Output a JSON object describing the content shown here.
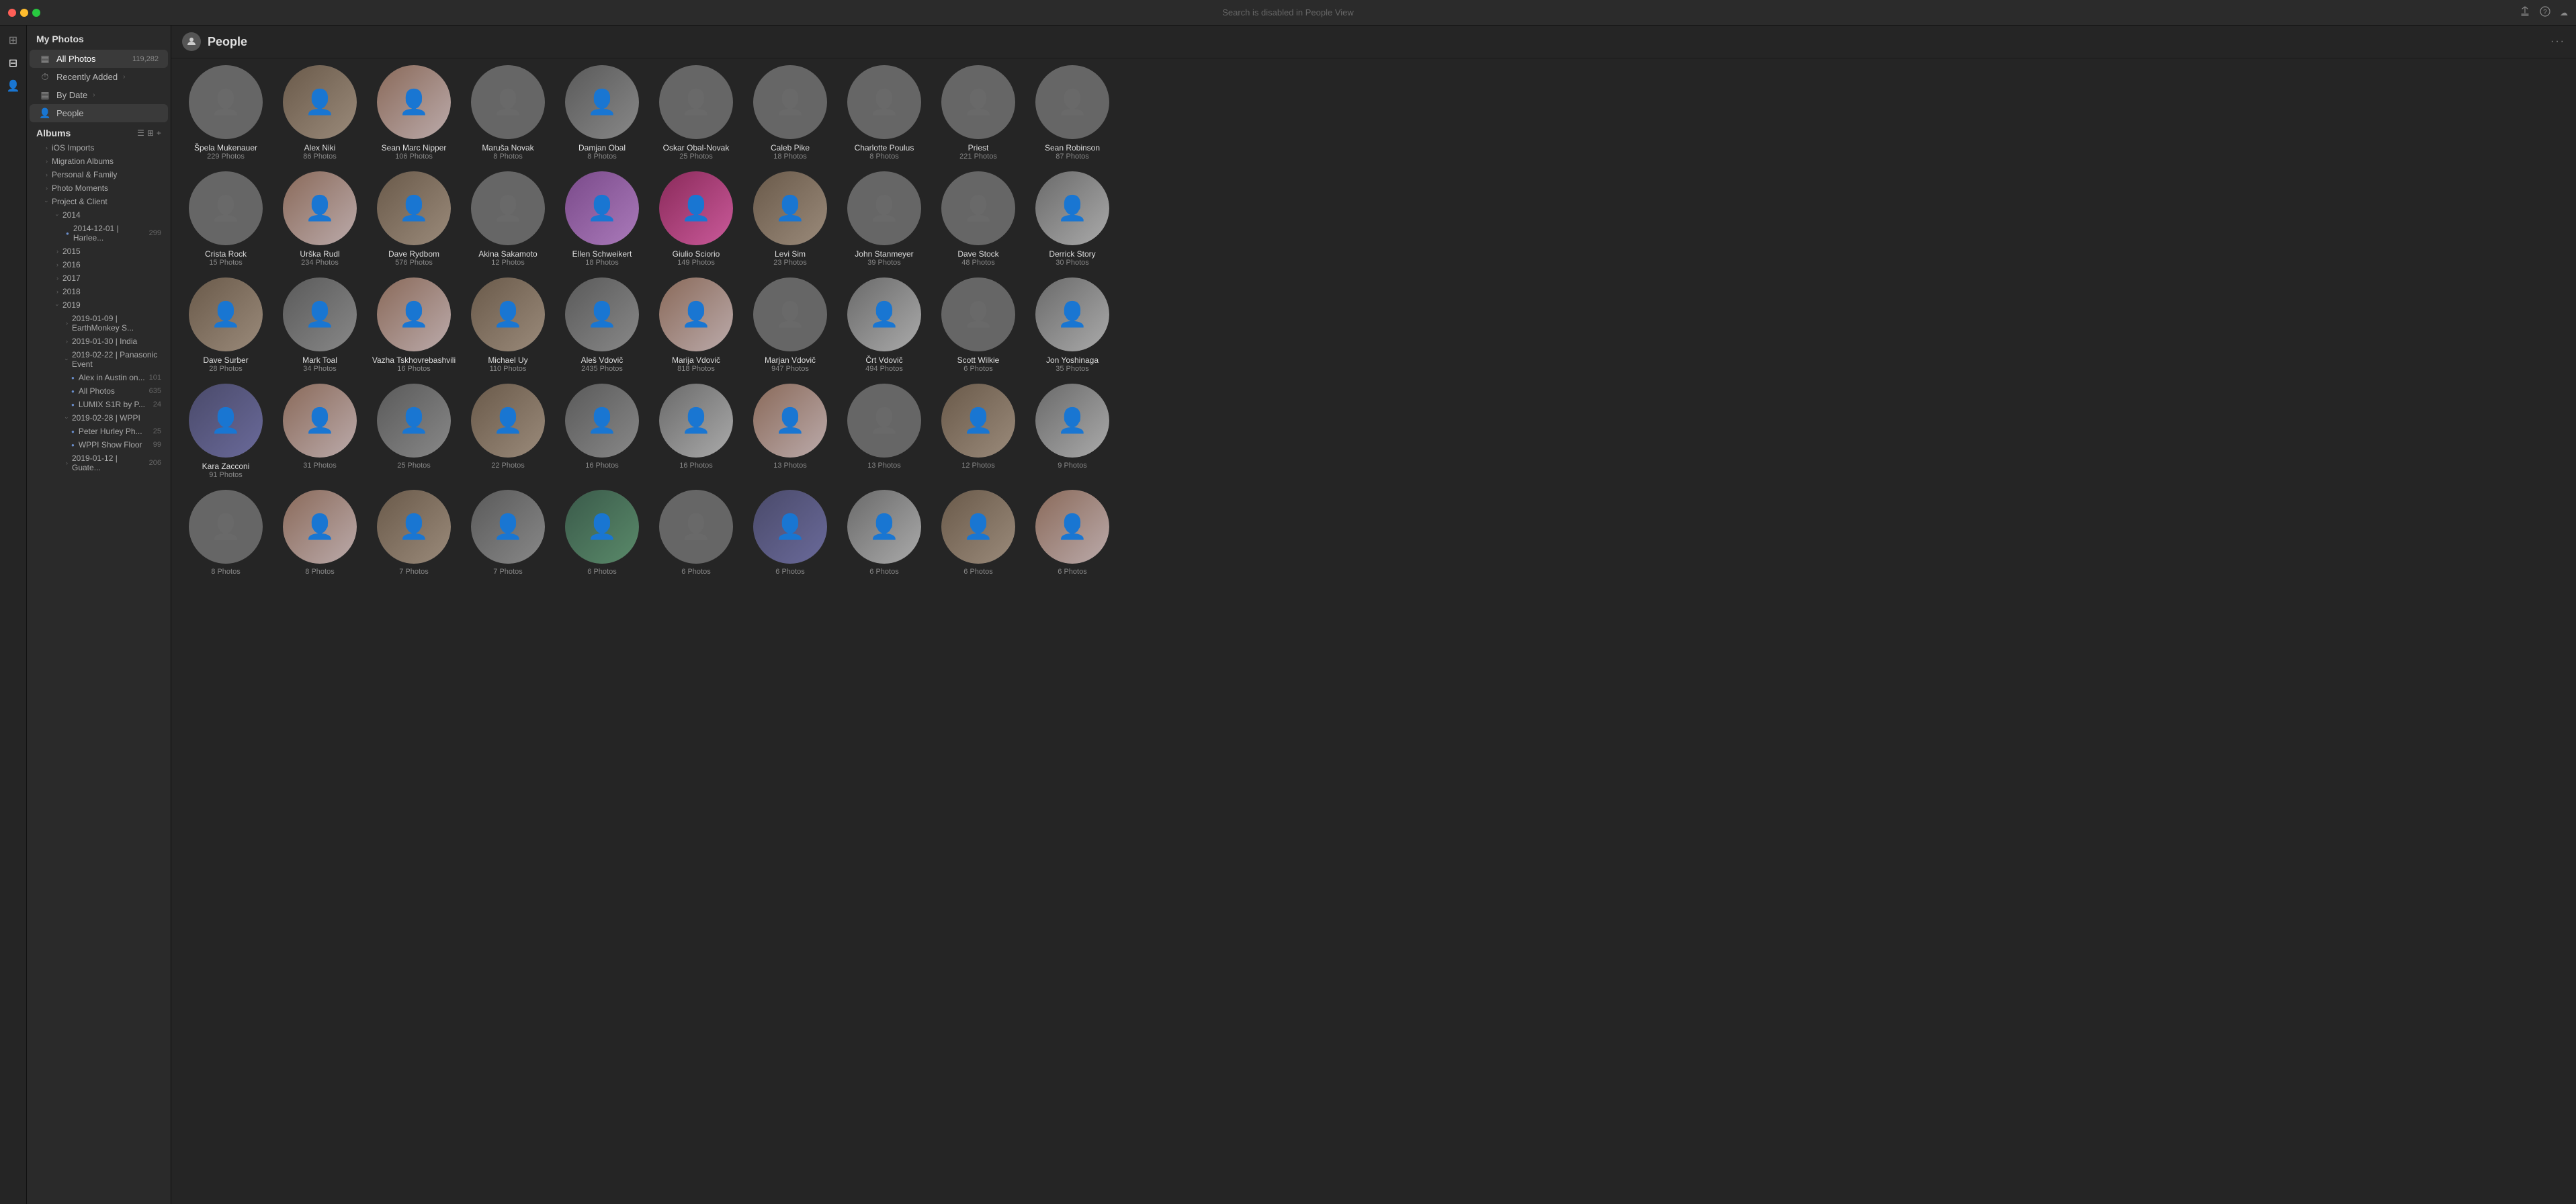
{
  "titlebar": {
    "search_placeholder": "Search is disabled in People View",
    "title": "Search is disabled in People View"
  },
  "sidebar": {
    "title": "My Photos",
    "items": [
      {
        "id": "all-photos",
        "label": "All Photos",
        "icon": "▦",
        "count": "119,282"
      },
      {
        "id": "recently-added",
        "label": "Recently Added",
        "icon": "⏱",
        "count": ""
      },
      {
        "id": "by-date",
        "label": "By Date",
        "icon": "▦",
        "count": ""
      },
      {
        "id": "people",
        "label": "People",
        "icon": "👤",
        "count": "",
        "active": true
      }
    ],
    "albums_title": "Albums",
    "album_sections": [
      {
        "label": "iOS Imports",
        "indent": 1,
        "type": "folder",
        "expanded": false
      },
      {
        "label": "Migration Albums",
        "indent": 1,
        "type": "folder",
        "expanded": false
      },
      {
        "label": "Personal & Family",
        "indent": 1,
        "type": "folder",
        "expanded": false
      },
      {
        "label": "Photo Moments",
        "indent": 1,
        "type": "folder",
        "expanded": false
      },
      {
        "label": "Project & Client",
        "indent": 1,
        "type": "folder",
        "expanded": true
      },
      {
        "label": "2014",
        "indent": 2,
        "type": "folder",
        "expanded": true
      },
      {
        "label": "2014-12-01 | Harlee...",
        "indent": 3,
        "type": "smart",
        "count": "299"
      },
      {
        "label": "2015",
        "indent": 2,
        "type": "folder",
        "expanded": false
      },
      {
        "label": "2016",
        "indent": 2,
        "type": "folder",
        "expanded": false
      },
      {
        "label": "2017",
        "indent": 2,
        "type": "folder",
        "expanded": false
      },
      {
        "label": "2018",
        "indent": 2,
        "type": "folder",
        "expanded": false
      },
      {
        "label": "2019",
        "indent": 2,
        "type": "folder",
        "expanded": true
      },
      {
        "label": "2019-01-09 | EarthMonkey S...",
        "indent": 3,
        "type": "folder",
        "expanded": false
      },
      {
        "label": "2019-01-30 | India",
        "indent": 3,
        "type": "folder",
        "expanded": false
      },
      {
        "label": "2019-02-22 | Panasonic Event",
        "indent": 3,
        "type": "folder",
        "expanded": true
      },
      {
        "label": "Alex in Austin on...",
        "indent": 4,
        "type": "smart",
        "count": "101"
      },
      {
        "label": "All Photos",
        "indent": 4,
        "type": "smart",
        "count": "635"
      },
      {
        "label": "LUMIX S1R by P...",
        "indent": 4,
        "type": "smart",
        "count": "24"
      },
      {
        "label": "2019-02-28 | WPPI",
        "indent": 3,
        "type": "folder",
        "expanded": true
      },
      {
        "label": "Peter Hurley Ph...",
        "indent": 4,
        "type": "smart",
        "count": "25"
      },
      {
        "label": "WPPI Show Floor",
        "indent": 4,
        "type": "smart",
        "count": "99"
      },
      {
        "label": "2019-01-12 | Guate...",
        "indent": 3,
        "type": "folder",
        "count": "206",
        "expanded": false
      }
    ]
  },
  "people_page": {
    "title": "People",
    "rows": [
      {
        "people": [
          {
            "name": "Špela Mukenauer",
            "count": "229 Photos",
            "color": "av-bw"
          },
          {
            "name": "Alex Niki",
            "count": "86 Photos",
            "color": "av-3"
          },
          {
            "name": "Sean Marc Nipper",
            "count": "106 Photos",
            "color": "av-5"
          },
          {
            "name": "Maruša Novak",
            "count": "8 Photos",
            "color": "av-bw"
          },
          {
            "name": "Damjan Obal",
            "count": "8 Photos",
            "color": "av-1"
          },
          {
            "name": "Oskar Obal-Novak",
            "count": "25 Photos",
            "color": "av-bw"
          },
          {
            "name": "Caleb Pike",
            "count": "18 Photos",
            "color": "av-bw"
          },
          {
            "name": "Charlotte Poulus",
            "count": "8 Photos",
            "color": "av-bw"
          },
          {
            "name": "Priest",
            "count": "221 Photos",
            "color": "av-bw"
          },
          {
            "name": "Sean Robinson",
            "count": "87 Photos",
            "color": "av-bw"
          }
        ]
      },
      {
        "people": [
          {
            "name": "Crista Rock",
            "count": "15 Photos",
            "color": "av-bw"
          },
          {
            "name": "Urška Rudl",
            "count": "234 Photos",
            "color": "av-5"
          },
          {
            "name": "Dave Rydbom",
            "count": "576 Photos",
            "color": "av-3"
          },
          {
            "name": "Akina Sakamoto",
            "count": "12 Photos",
            "color": "av-bw"
          },
          {
            "name": "Ellen Schweikert",
            "count": "18 Photos",
            "color": "av-2"
          },
          {
            "name": "Giulio Sciorio",
            "count": "149 Photos",
            "color": "av-4"
          },
          {
            "name": "Levi Sim",
            "count": "23 Photos",
            "color": "av-3"
          },
          {
            "name": "John Stanmeyer",
            "count": "39 Photos",
            "color": "av-bw"
          },
          {
            "name": "Dave Stock",
            "count": "48 Photos",
            "color": "av-bw"
          },
          {
            "name": "Derrick Story",
            "count": "30 Photos",
            "color": "av-6"
          }
        ]
      },
      {
        "people": [
          {
            "name": "Dave Surber",
            "count": "28 Photos",
            "color": "av-3"
          },
          {
            "name": "Mark Toal",
            "count": "34 Photos",
            "color": "av-1"
          },
          {
            "name": "Vazha Tskhovrebashvili",
            "count": "16 Photos",
            "color": "av-5"
          },
          {
            "name": "Michael Uy",
            "count": "110 Photos",
            "color": "av-3"
          },
          {
            "name": "Aleš Vdovič",
            "count": "2435 Photos",
            "color": "av-1"
          },
          {
            "name": "Marija Vdovič",
            "count": "818 Photos",
            "color": "av-5"
          },
          {
            "name": "Marjan Vdovič",
            "count": "947 Photos",
            "color": "av-bw"
          },
          {
            "name": "Črt Vdovič",
            "count": "494 Photos",
            "color": "av-6"
          },
          {
            "name": "Scott Wilkie",
            "count": "6 Photos",
            "color": "av-bw"
          },
          {
            "name": "Jon Yoshinaga",
            "count": "35 Photos",
            "color": "av-6"
          }
        ]
      },
      {
        "people": [
          {
            "name": "Kara Zacconi",
            "count": "91 Photos",
            "color": "av-2"
          },
          {
            "name": "",
            "count": "31 Photos",
            "color": "av-5"
          },
          {
            "name": "",
            "count": "25 Photos",
            "color": "av-1"
          },
          {
            "name": "",
            "count": "22 Photos",
            "color": "av-3"
          },
          {
            "name": "",
            "count": "16 Photos",
            "color": "av-1"
          },
          {
            "name": "",
            "count": "16 Photos",
            "color": "av-6"
          },
          {
            "name": "",
            "count": "13 Photos",
            "color": "av-5"
          },
          {
            "name": "",
            "count": "13 Photos",
            "color": "av-bw"
          },
          {
            "name": "",
            "count": "12 Photos",
            "color": "av-3"
          },
          {
            "name": "",
            "count": "9 Photos",
            "color": "av-6"
          }
        ]
      },
      {
        "people": [
          {
            "name": "",
            "count": "8 Photos",
            "color": "av-bw"
          },
          {
            "name": "",
            "count": "8 Photos",
            "color": "av-5"
          },
          {
            "name": "",
            "count": "7 Photos",
            "color": "av-3"
          },
          {
            "name": "",
            "count": "7 Photos",
            "color": "av-1"
          },
          {
            "name": "",
            "count": "6 Photos",
            "color": "av-4"
          },
          {
            "name": "",
            "count": "6 Photos",
            "color": "av-bw"
          },
          {
            "name": "",
            "count": "6 Photos",
            "color": "av-2"
          },
          {
            "name": "",
            "count": "6 Photos",
            "color": "av-6"
          },
          {
            "name": "",
            "count": "6 Photos",
            "color": "av-3"
          },
          {
            "name": "",
            "count": "6 Photos",
            "color": "av-5"
          }
        ]
      }
    ]
  }
}
